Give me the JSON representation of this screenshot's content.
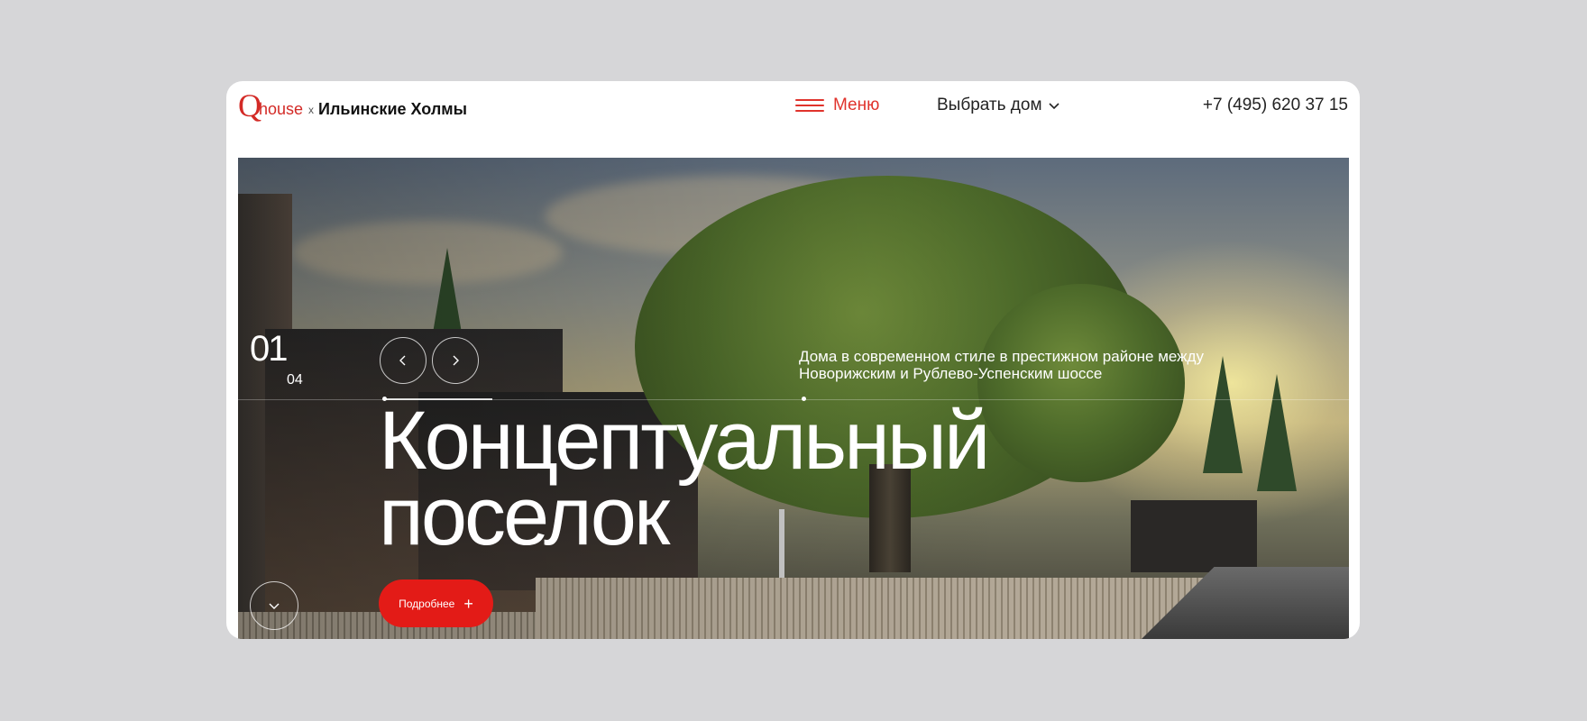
{
  "header": {
    "logo_q": "Q",
    "logo_house": "house",
    "logo_separator": "x",
    "logo_place": "Ильинские Холмы",
    "menu_label": "Меню",
    "choose_label": "Выбрать дом",
    "phone": "+7 (495) 620 37 15"
  },
  "hero": {
    "slide_current": "01",
    "slide_total": "04",
    "description": "Дома в современном стиле в престижном районе между Новорижским и Рублево-Успенским шоссе",
    "title_line1": "Концептуальный",
    "title_line2": "поселок",
    "more_label": "Подробнее",
    "more_icon": "+"
  },
  "colors": {
    "accent": "#e31b17",
    "brand_red": "#d32a26",
    "background": "#d6d6d8"
  },
  "icons": [
    "hamburger-icon",
    "chevron-down-icon",
    "arrow-left-icon",
    "arrow-right-icon",
    "plus-icon",
    "scroll-down-icon"
  ]
}
